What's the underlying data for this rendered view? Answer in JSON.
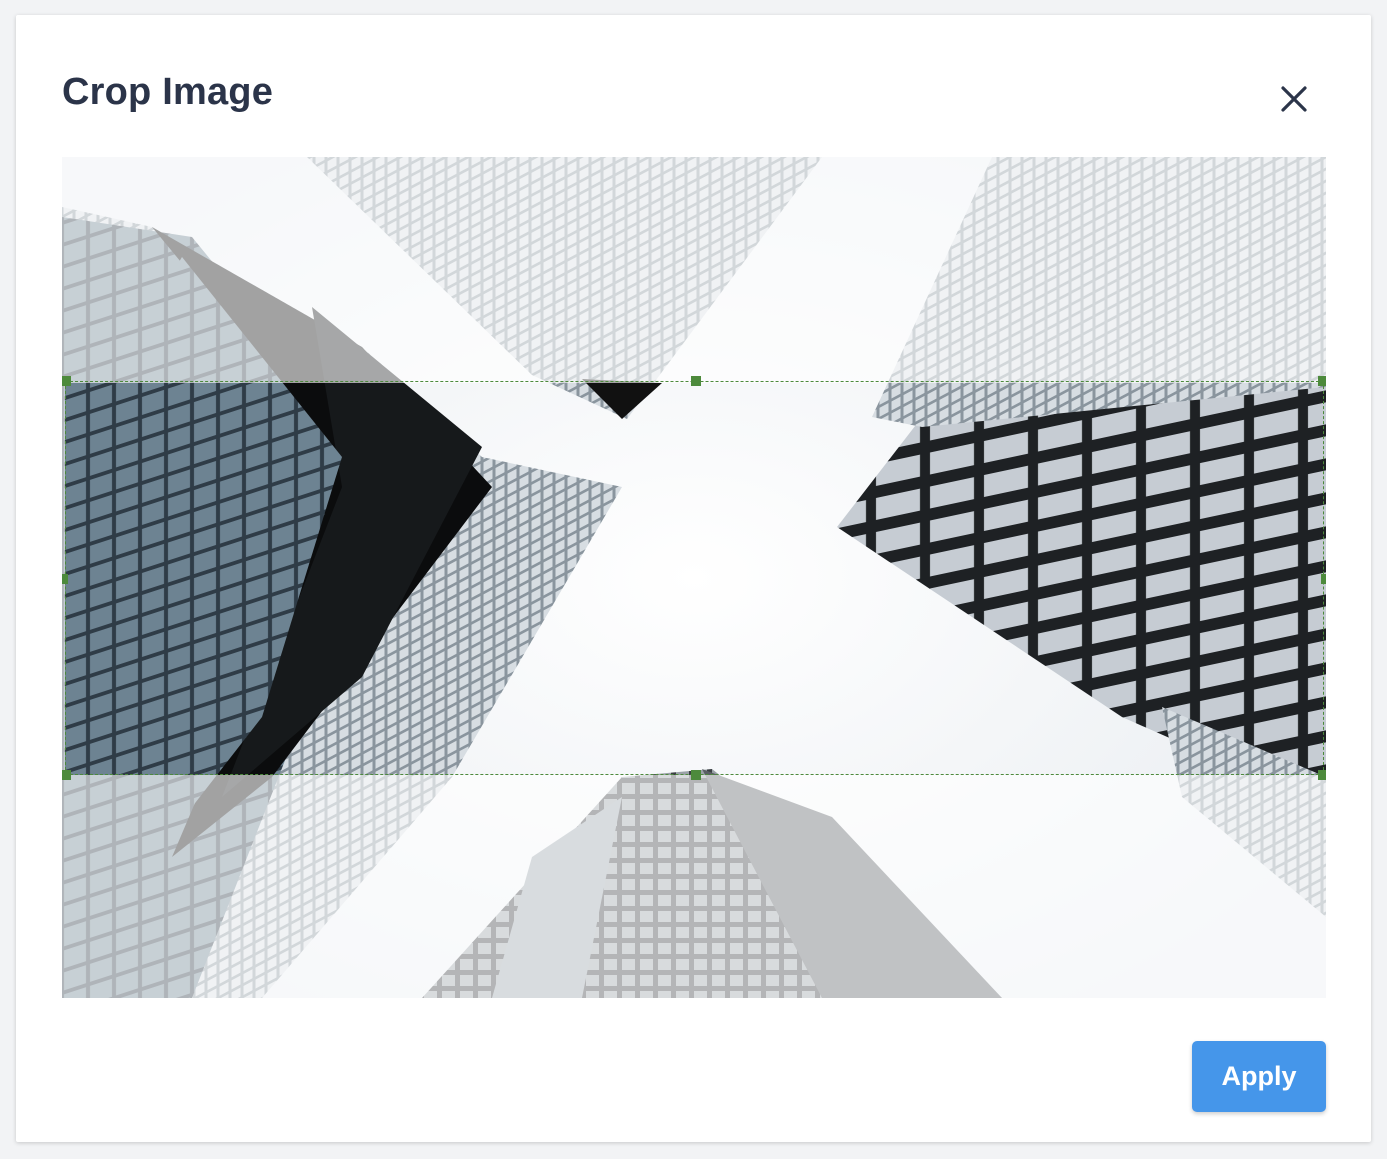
{
  "dialog": {
    "title": "Crop Image",
    "close_icon": "close-icon",
    "apply_label": "Apply"
  },
  "image": {
    "subject": "skyscrapers"
  },
  "colors": {
    "accent": "#4596ea",
    "crop_border": "#4d8a3c",
    "title": "#2b3449"
  }
}
